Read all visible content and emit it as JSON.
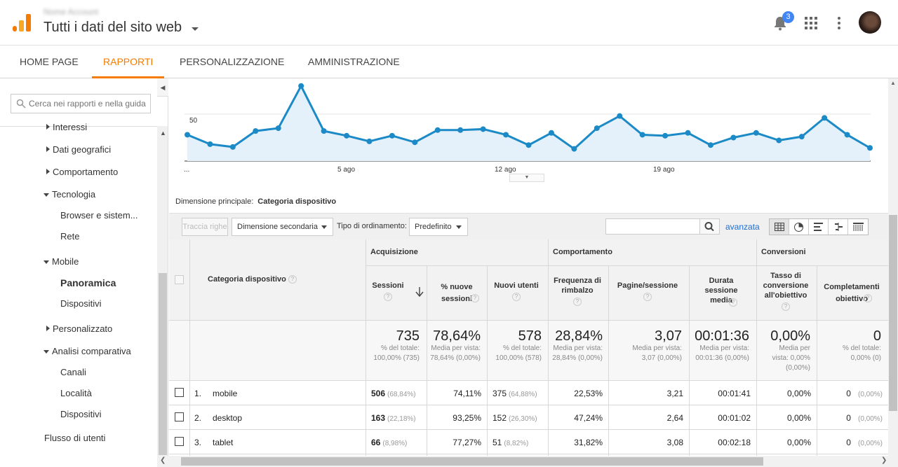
{
  "header": {
    "account_name": "Nome Account",
    "property_title": "Tutti i dati del sito web",
    "notification_count": "3",
    "colors": {
      "brand": "#f57c00",
      "badge": "#4285f4"
    }
  },
  "nav": {
    "tabs": [
      {
        "label": "HOME PAGE"
      },
      {
        "label": "RAPPORTI"
      },
      {
        "label": "PERSONALIZZAZIONE"
      },
      {
        "label": "AMMINISTRAZIONE"
      }
    ],
    "active": "RAPPORTI"
  },
  "sidebar": {
    "search_placeholder": "Cerca nei rapporti e nella guida",
    "items": [
      {
        "label": "Interessi"
      },
      {
        "label": "Dati geografici"
      },
      {
        "label": "Comportamento"
      },
      {
        "label": "Tecnologia"
      },
      {
        "label": "Browser e sistem..."
      },
      {
        "label": "Rete"
      },
      {
        "label": "Mobile"
      },
      {
        "label": "Panoramica"
      },
      {
        "label": "Dispositivi"
      },
      {
        "label": "Personalizzato"
      },
      {
        "label": "Analisi comparativa"
      },
      {
        "label": "Canali"
      },
      {
        "label": "Località"
      },
      {
        "label": "Dispositivi"
      },
      {
        "label": "Flusso di utenti"
      }
    ]
  },
  "chart_data": {
    "type": "area",
    "y_tick_label": "50",
    "x_tick_labels": [
      "...",
      "5 ago",
      "12 ago",
      "19 ago"
    ],
    "values": [
      28,
      18,
      15,
      32,
      35,
      80,
      32,
      27,
      21,
      27,
      20,
      33,
      33,
      34,
      28,
      17,
      30,
      13,
      35,
      48,
      28,
      27,
      30,
      17,
      25,
      30,
      22,
      26,
      46,
      28,
      14
    ],
    "color": "#1b8ac7"
  },
  "dimension": {
    "label": "Dimensione principale:",
    "value": "Categoria dispositivo"
  },
  "toolbar": {
    "plot_rows": "Traccia righe",
    "secondary_dimension": "Dimensione secondaria",
    "sort_label": "Tipo di ordinamento:",
    "sort_value": "Predefinito",
    "advanced": "avanzata"
  },
  "table": {
    "groups": {
      "acquisition": "Acquisizione",
      "behavior": "Comportamento",
      "conversions": "Conversioni"
    },
    "dimension_header": "Categoria dispositivo",
    "headers": {
      "sessions": "Sessioni",
      "new_sessions": "% nuove sessioni",
      "new_users": "Nuovi utenti",
      "bounce": "Frequenza di rimbalzo",
      "pages": "Pagine/sessione",
      "duration": "Durata sessione media",
      "conv_rate": "Tasso di conversione all'obiettivo",
      "completions": "Completamenti obiettivo"
    },
    "totals": {
      "sessions": "735",
      "sessions_sub": "% del totale: 100,00% (735)",
      "new_sessions": "78,64%",
      "new_sessions_sub": "Media per vista: 78,64% (0,00%)",
      "new_users": "578",
      "new_users_sub": "% del totale: 100,00% (578)",
      "bounce": "28,84%",
      "bounce_sub": "Media per vista: 28,84% (0,00%)",
      "pages": "3,07",
      "pages_sub": "Media per vista: 3,07 (0,00%)",
      "duration": "00:01:36",
      "duration_sub": "Media per vista: 00:01:36 (0,00%)",
      "conv_rate": "0,00%",
      "conv_rate_sub": "Media per vista: 0,00% (0,00%)",
      "completions": "0",
      "completions_sub": "% del totale: 0,00% (0)"
    },
    "rows": [
      {
        "index": "1.",
        "name": "mobile",
        "sessions": "506",
        "sessions_pct": "(68,84%)",
        "new_sessions": "74,11%",
        "new_users": "375",
        "new_users_pct": "(64,88%)",
        "bounce": "22,53%",
        "pages": "3,21",
        "duration": "00:01:41",
        "conv_rate": "0,00%",
        "completions": "0",
        "completions_pct": "(0,00%)"
      },
      {
        "index": "2.",
        "name": "desktop",
        "sessions": "163",
        "sessions_pct": "(22,18%)",
        "new_sessions": "93,25%",
        "new_users": "152",
        "new_users_pct": "(26,30%)",
        "bounce": "47,24%",
        "pages": "2,64",
        "duration": "00:01:02",
        "conv_rate": "0,00%",
        "completions": "0",
        "completions_pct": "(0,00%)"
      },
      {
        "index": "3.",
        "name": "tablet",
        "sessions": "66",
        "sessions_pct": "(8,98%)",
        "new_sessions": "77,27%",
        "new_users": "51",
        "new_users_pct": "(8,82%)",
        "bounce": "31,82%",
        "pages": "3,08",
        "duration": "00:02:18",
        "conv_rate": "0,00%",
        "completions": "0",
        "completions_pct": "(0,00%)"
      }
    ]
  }
}
